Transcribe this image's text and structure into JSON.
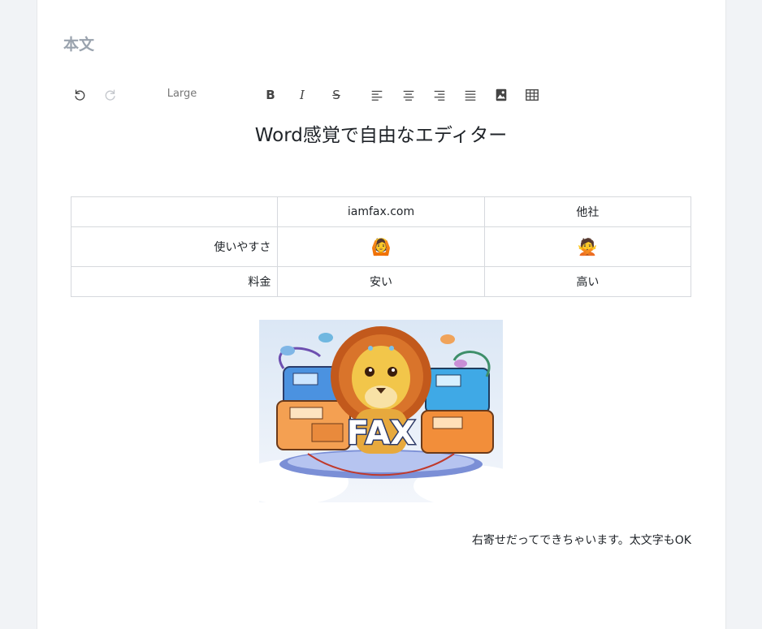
{
  "section": {
    "title": "本文"
  },
  "toolbar": {
    "undo_icon": "undo-icon",
    "redo_icon": "redo-icon",
    "font_size": "Large",
    "bold_icon": "B",
    "italic_icon": "I",
    "strike_icon": "S",
    "align_icons": [
      "align-left-icon",
      "align-center-icon",
      "align-right-icon",
      "align-justify-icon"
    ],
    "image_icon": "image-icon",
    "table_icon": "table-icon"
  },
  "document": {
    "heading": "Word感覚で自由なエディター",
    "table": {
      "header": [
        "",
        "iamfax.com",
        "他社"
      ],
      "rows": [
        [
          "使いやすさ",
          "🙆",
          "🙅"
        ],
        [
          "料金",
          "安い",
          "高い"
        ]
      ]
    },
    "image": {
      "overlay_text": "FAX"
    },
    "footer_text": "右寄せだってできちゃいます。太文字もOK"
  },
  "colors": {
    "page_background": "#f1f3f6",
    "card_background": "#ffffff",
    "title_gray": "#9aa3ae",
    "border": "#d6d9dd"
  }
}
